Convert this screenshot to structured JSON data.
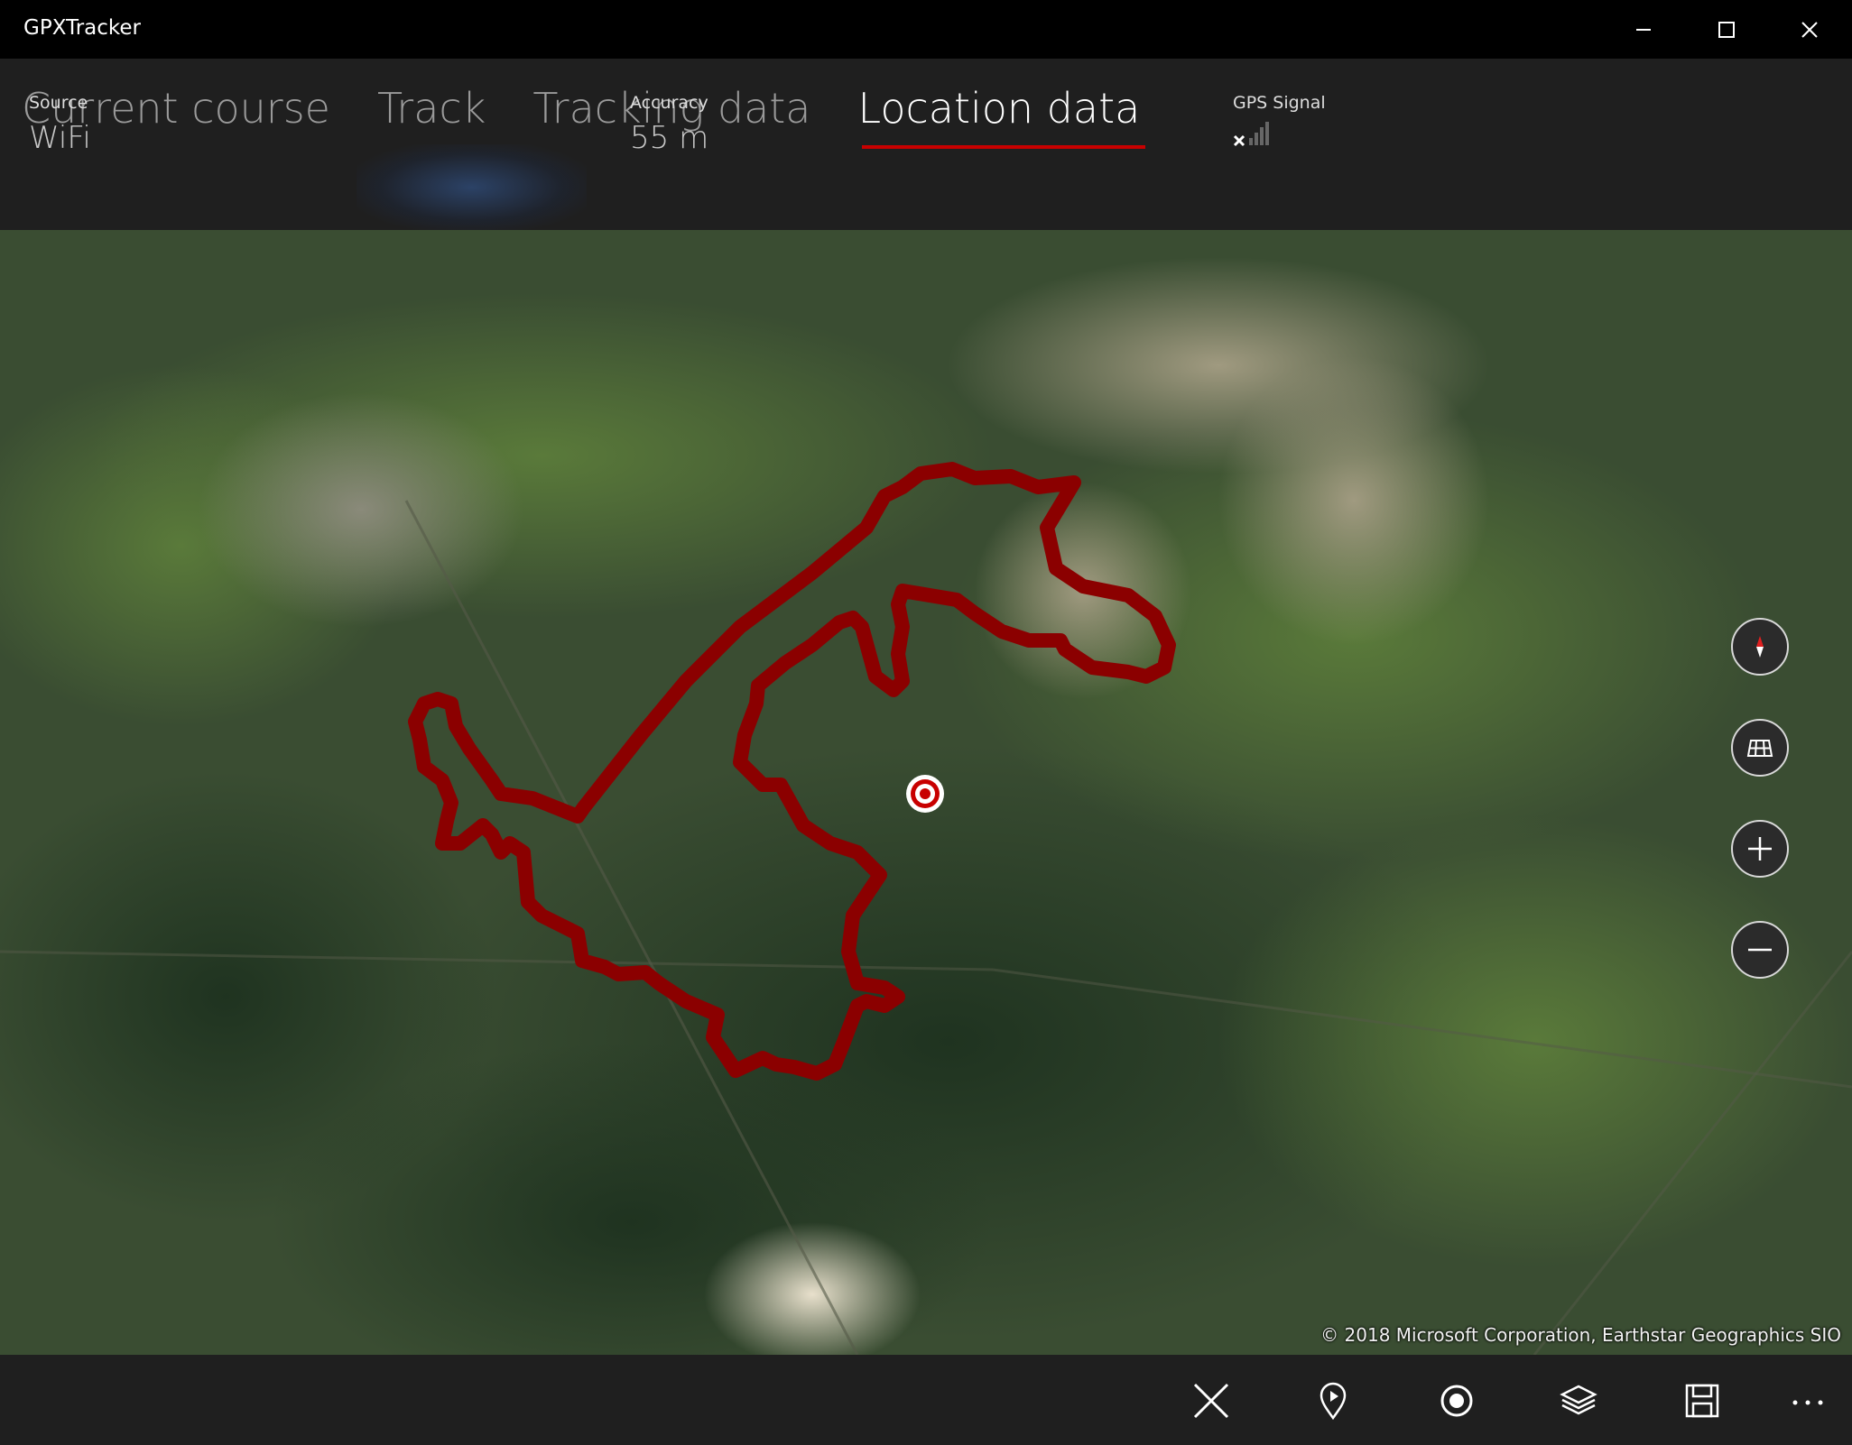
{
  "app": {
    "title": "GPXTracker"
  },
  "tabs": [
    {
      "label": "Current course"
    },
    {
      "label": "Track"
    },
    {
      "label": "Tracking data"
    },
    {
      "label": "Location data"
    }
  ],
  "active_tab": "Location data",
  "location": {
    "source_label": "Source",
    "source_value": "WiFi",
    "accuracy_label": "Accuracy",
    "accuracy_value": "55 m",
    "gps_label": "GPS Signal",
    "gps_icon": "signal-no-gps-icon"
  },
  "map": {
    "copyright": "© 2018 Microsoft Corporation, Earthstar Geographics  SIO",
    "track_color": "#8b0000",
    "controls": [
      "compass-icon",
      "map-style-icon",
      "zoom-in-icon",
      "zoom-out-icon"
    ]
  },
  "commands": [
    "close-icon",
    "location-pin-icon",
    "record-icon",
    "layers-icon",
    "save-icon",
    "more-icon"
  ],
  "colors": {
    "accent": "#c80000",
    "background": "#1f1f1f",
    "titlebar": "#000000"
  }
}
